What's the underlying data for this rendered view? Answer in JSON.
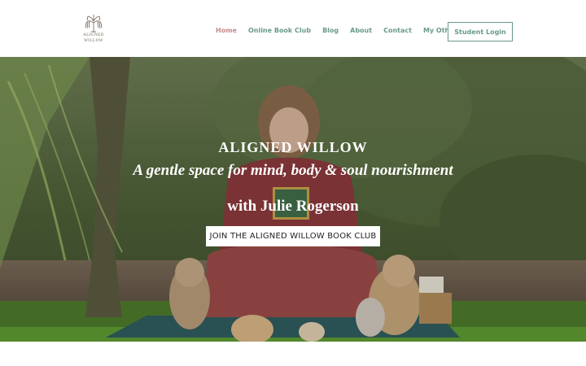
{
  "brand": {
    "line1": "ALIGNED",
    "line2": "WILLOW",
    "logo_icon": "willow-tree-icon"
  },
  "nav": {
    "items": [
      {
        "label": "Home",
        "active": true
      },
      {
        "label": "Online Book Club",
        "active": false
      },
      {
        "label": "Blog",
        "active": false
      },
      {
        "label": "About",
        "active": false
      },
      {
        "label": "Contact",
        "active": false
      },
      {
        "label": "My Other Services",
        "active": false
      }
    ],
    "login_label": "Student Login"
  },
  "hero": {
    "title": "ALIGNED WILLOW",
    "subtitle": "A gentle space for mind, body & soul nourishment",
    "with_line": "with Julie Rogerson",
    "cta_label": "JOIN THE ALIGNED WILLOW BOOK CLUB"
  },
  "colors": {
    "nav_text": "#6a9a86",
    "nav_active": "#c48a8a",
    "hero_text": "#ffffff",
    "cta_bg": "#ffffff"
  }
}
